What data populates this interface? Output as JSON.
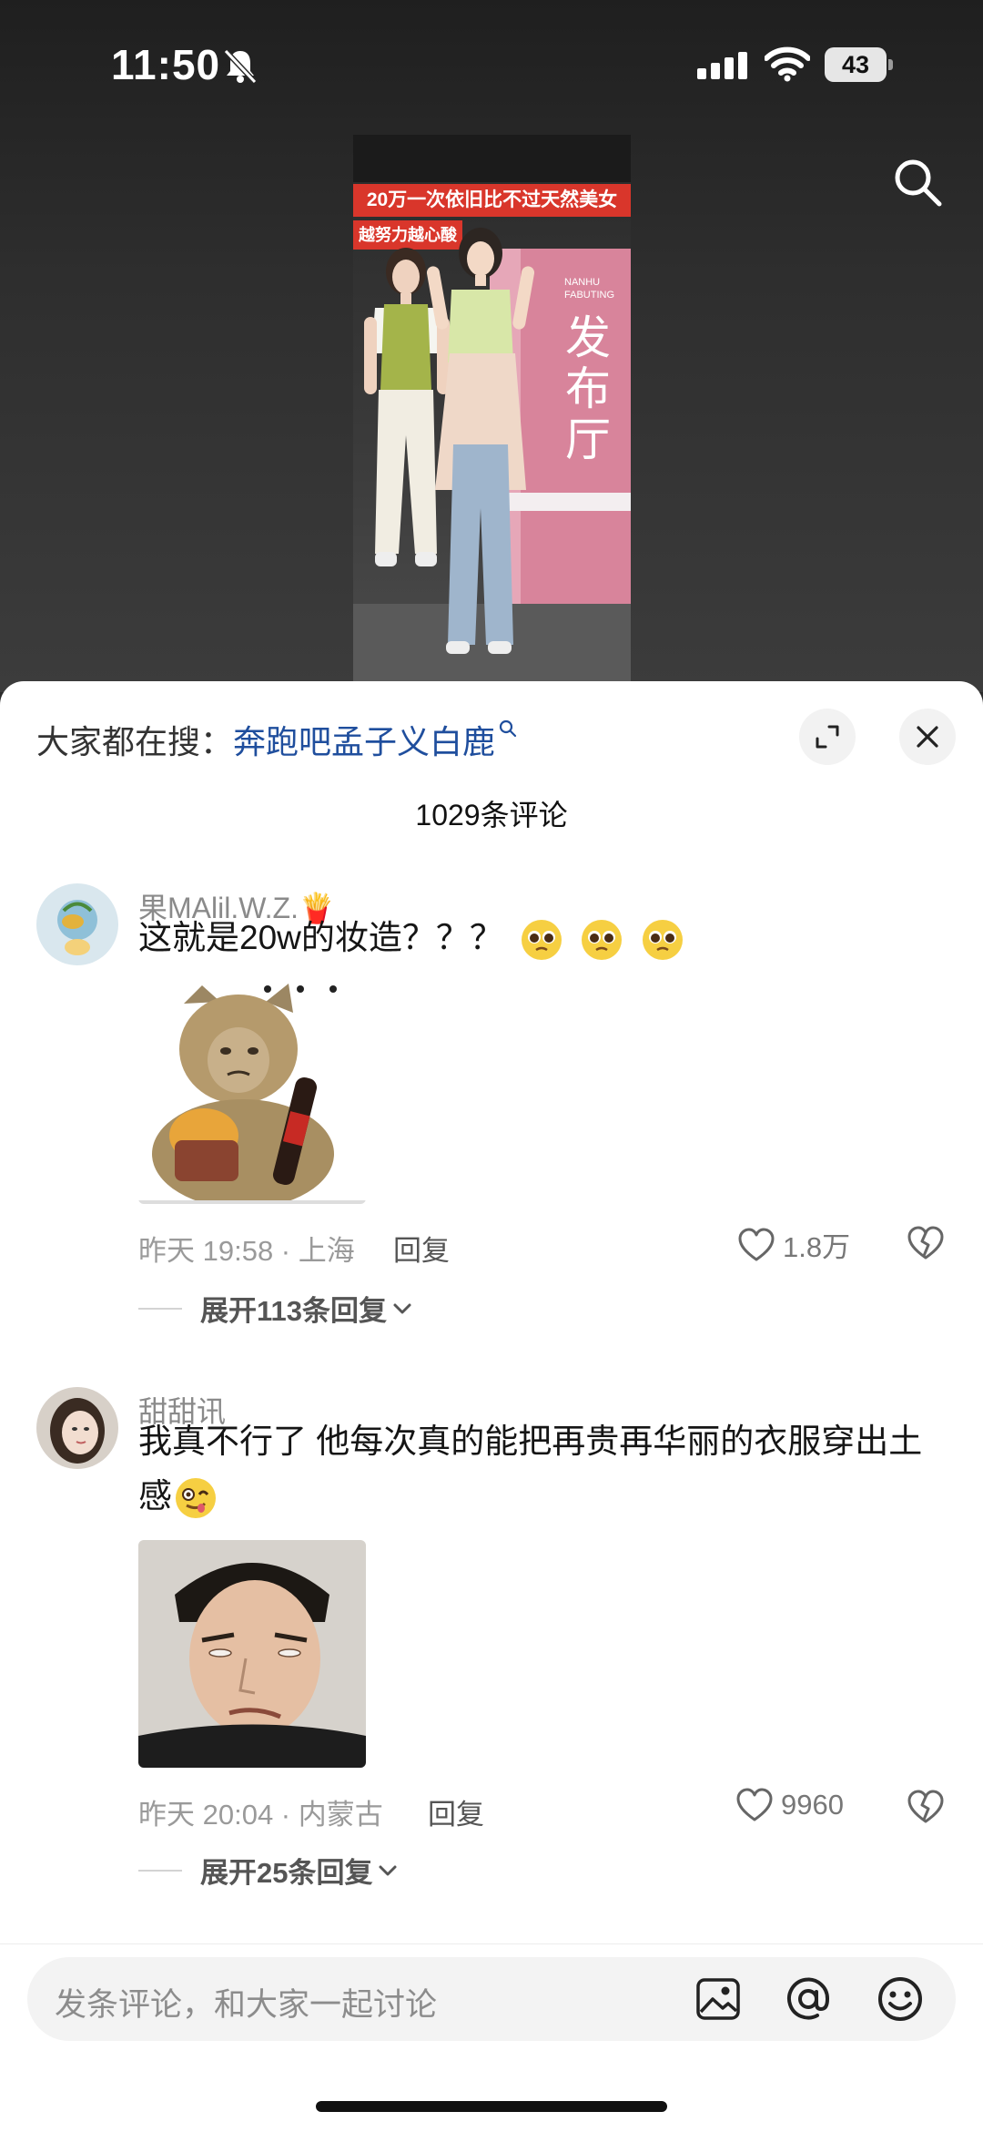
{
  "status_bar": {
    "time": "11:50",
    "battery": "43"
  },
  "video": {
    "headline": "20万一次依旧比不过天然美女",
    "subline": "越努力越心酸",
    "banner_small_1": "NANHU",
    "banner_small_2": "FABUTING",
    "banner_big": "发布厅"
  },
  "sheet": {
    "trending_prefix": "大家都在搜：",
    "trending_link": "奔跑吧孟子义白鹿",
    "comments_count": "1029条评论"
  },
  "comments": [
    {
      "username": "果MAlil.W.Z.🍟",
      "text": "这就是20w的妆造？？？",
      "time_location": "昨天 19:58 · 上海",
      "reply_label": "回复",
      "likes": "1.8万",
      "expand_label": "展开113条回复"
    },
    {
      "username": "甜甜讯",
      "text": "我真不行了 他每次真的能把再贵再华丽的衣服穿出土感",
      "time_location": "昨天 20:04 · 内蒙古",
      "reply_label": "回复",
      "likes": "9960",
      "expand_label": "展开25条回复"
    }
  ],
  "input": {
    "placeholder": "发条评论，和大家一起讨论"
  },
  "colors": {
    "link": "#1f4e9d",
    "headline_red": "#d9362b",
    "banner_pink": "#d8849b"
  }
}
